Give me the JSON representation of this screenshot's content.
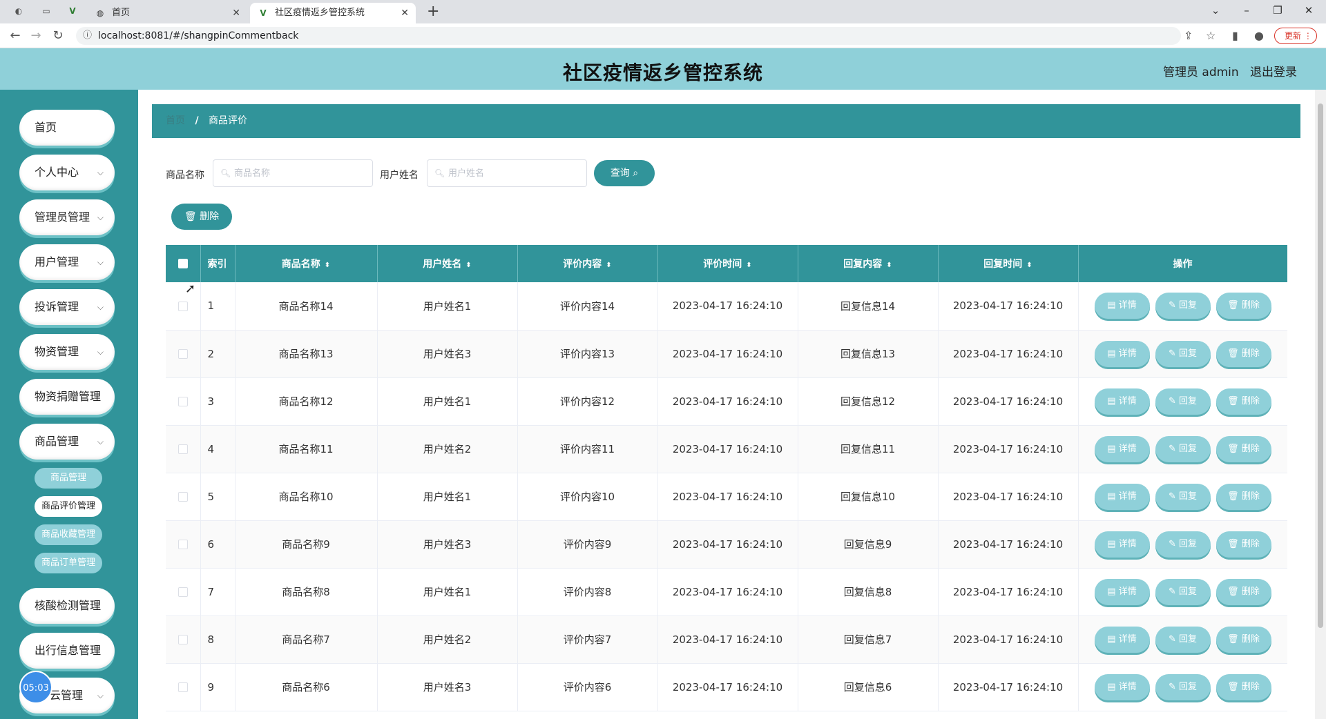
{
  "browser": {
    "tabs": [
      {
        "title": "首页",
        "active": false
      },
      {
        "title": "社区疫情返乡管控系统",
        "active": true
      }
    ],
    "url": "localhost:8081/#/shangpinCommentback",
    "update_label": "更新"
  },
  "header": {
    "title": "社区疫情返乡管控系统",
    "user_label": "管理员 admin",
    "logout_label": "退出登录"
  },
  "sidebar": {
    "items": [
      {
        "label": "首页",
        "has_children": false
      },
      {
        "label": "个人中心",
        "has_children": true
      },
      {
        "label": "管理员管理",
        "has_children": true
      },
      {
        "label": "用户管理",
        "has_children": true
      },
      {
        "label": "投诉管理",
        "has_children": true
      },
      {
        "label": "物资管理",
        "has_children": true
      },
      {
        "label": "物资捐赠管理",
        "has_children": false
      },
      {
        "label": "商品管理",
        "has_children": true
      },
      {
        "label": "核酸检测管理",
        "has_children": false
      },
      {
        "label": "出行信息管理",
        "has_children": false
      },
      {
        "label": "云管理",
        "has_children": true
      }
    ],
    "sub_items": [
      {
        "label": "商品管理",
        "active": false
      },
      {
        "label": "商品评价管理",
        "active": true
      },
      {
        "label": "商品收藏管理",
        "active": false
      },
      {
        "label": "商品订单管理",
        "active": false
      }
    ],
    "clock": "05:03"
  },
  "breadcrumb": {
    "home": "首页",
    "separator": "/",
    "current": "商品评价"
  },
  "search": {
    "product_label": "商品名称",
    "product_placeholder": "商品名称",
    "user_label": "用户姓名",
    "user_placeholder": "用户姓名",
    "query_label": "查询"
  },
  "toolbar": {
    "delete_label": "删除"
  },
  "table": {
    "columns": [
      "索引",
      "商品名称",
      "用户姓名",
      "评价内容",
      "评价时间",
      "回复内容",
      "回复时间",
      "操作"
    ],
    "actions": {
      "detail": "详情",
      "reply": "回复",
      "delete": "删除"
    },
    "rows": [
      {
        "index": "1",
        "product": "商品名称14",
        "user": "用户姓名1",
        "content": "评价内容14",
        "time": "2023-04-17 16:24:10",
        "reply": "回复信息14",
        "reply_time": "2023-04-17 16:24:10"
      },
      {
        "index": "2",
        "product": "商品名称13",
        "user": "用户姓名3",
        "content": "评价内容13",
        "time": "2023-04-17 16:24:10",
        "reply": "回复信息13",
        "reply_time": "2023-04-17 16:24:10"
      },
      {
        "index": "3",
        "product": "商品名称12",
        "user": "用户姓名1",
        "content": "评价内容12",
        "time": "2023-04-17 16:24:10",
        "reply": "回复信息12",
        "reply_time": "2023-04-17 16:24:10"
      },
      {
        "index": "4",
        "product": "商品名称11",
        "user": "用户姓名2",
        "content": "评价内容11",
        "time": "2023-04-17 16:24:10",
        "reply": "回复信息11",
        "reply_time": "2023-04-17 16:24:10"
      },
      {
        "index": "5",
        "product": "商品名称10",
        "user": "用户姓名1",
        "content": "评价内容10",
        "time": "2023-04-17 16:24:10",
        "reply": "回复信息10",
        "reply_time": "2023-04-17 16:24:10"
      },
      {
        "index": "6",
        "product": "商品名称9",
        "user": "用户姓名3",
        "content": "评价内容9",
        "time": "2023-04-17 16:24:10",
        "reply": "回复信息9",
        "reply_time": "2023-04-17 16:24:10"
      },
      {
        "index": "7",
        "product": "商品名称8",
        "user": "用户姓名1",
        "content": "评价内容8",
        "time": "2023-04-17 16:24:10",
        "reply": "回复信息8",
        "reply_time": "2023-04-17 16:24:10"
      },
      {
        "index": "8",
        "product": "商品名称7",
        "user": "用户姓名2",
        "content": "评价内容7",
        "time": "2023-04-17 16:24:10",
        "reply": "回复信息7",
        "reply_time": "2023-04-17 16:24:10"
      },
      {
        "index": "9",
        "product": "商品名称6",
        "user": "用户姓名3",
        "content": "评价内容6",
        "time": "2023-04-17 16:24:10",
        "reply": "回复信息6",
        "reply_time": "2023-04-17 16:24:10"
      }
    ]
  },
  "colors": {
    "primary": "#31949a",
    "light": "#8fd0d9",
    "header": "#8fd0d9"
  }
}
